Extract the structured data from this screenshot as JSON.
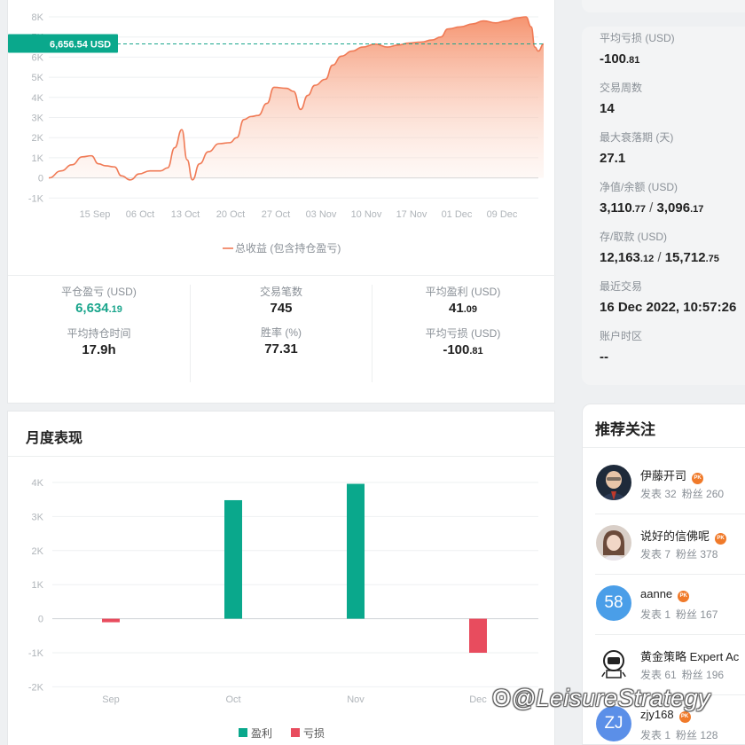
{
  "equity_chart": {
    "y_ticks": [
      "8K",
      "7K",
      "6K",
      "5K",
      "4K",
      "3K",
      "2K",
      "1K",
      "0",
      "-1K"
    ],
    "x_ticks": [
      "15 Sep",
      "06 Oct",
      "13 Oct",
      "20 Oct",
      "27 Oct",
      "03 Nov",
      "10 Nov",
      "17 Nov",
      "01 Dec",
      "09 Dec"
    ],
    "current_value_label": "6,656.54 USD",
    "legend": "总收益 (包含持仓盈亏)",
    "line_color": "#f07a55"
  },
  "stats": {
    "close_pnl": {
      "label": "平仓盈亏 (USD)",
      "int": "6,634",
      "dec": ".19"
    },
    "trade_count": {
      "label": "交易笔数",
      "value": "745"
    },
    "avg_profit": {
      "label": "平均盈利 (USD)",
      "int": "41",
      "dec": ".09"
    },
    "avg_hold_time": {
      "label": "平均持仓时间",
      "value": "17.9h"
    },
    "win_rate": {
      "label": "胜率 (%)",
      "value": "77.31"
    },
    "avg_loss": {
      "label": "平均亏损 (USD)",
      "int": "-100",
      "dec": ".81"
    }
  },
  "monthly": {
    "title": "月度表现",
    "y_ticks": [
      "4K",
      "3K",
      "2K",
      "1K",
      "0",
      "-1K",
      "-2K"
    ],
    "legend_profit": "盈利",
    "legend_loss": "亏损",
    "profit_color": "#0aa88c",
    "loss_color": "#e84c5e"
  },
  "chart_data": [
    {
      "type": "area",
      "series": [
        {
          "name": "总收益 (包含持仓盈亏)",
          "points": [
            [
              "start",
              0
            ],
            [
              "15 Sep",
              1100
            ],
            [
              "late Sep",
              600
            ],
            [
              "06 Oct",
              300
            ],
            [
              "13 Oct",
              2400
            ],
            [
              "13 Oct+",
              -100
            ],
            [
              "20 Oct",
              1700
            ],
            [
              "27 Oct",
              4500
            ],
            [
              "03 Nov",
              5000
            ],
            [
              "10 Nov",
              6600
            ],
            [
              "17 Nov",
              6700
            ],
            [
              "01 Dec",
              7700
            ],
            [
              "09 Dec",
              7900
            ],
            [
              "16 Dec",
              6656.54
            ]
          ]
        }
      ],
      "x_ticks": [
        "15 Sep",
        "06 Oct",
        "13 Oct",
        "20 Oct",
        "27 Oct",
        "03 Nov",
        "10 Nov",
        "17 Nov",
        "01 Dec",
        "09 Dec"
      ],
      "ylim": [
        -1000,
        8000
      ],
      "current_value": 6656.54
    },
    {
      "type": "bar",
      "categories": [
        "Sep",
        "Oct",
        "Nov",
        "Dec"
      ],
      "series": [
        {
          "name": "盈利",
          "values": [
            0,
            3480,
            3960,
            0
          ]
        },
        {
          "name": "亏损",
          "values": [
            -100,
            0,
            0,
            -1000
          ]
        }
      ],
      "ylim": [
        -2000,
        4000
      ]
    }
  ],
  "account_info": [
    {
      "label": "平均亏损 (USD)",
      "int": "-100",
      "dec": ".81"
    },
    {
      "label": "交易周数",
      "value": "14"
    },
    {
      "label": "最大衰落期 (天)",
      "value": "27.1"
    },
    {
      "label": "净值/余额 (USD)",
      "a_int": "3,110",
      "a_dec": ".77",
      "b_int": "3,096",
      "b_dec": ".17"
    },
    {
      "label": "存/取款 (USD)",
      "a_int": "12,163",
      "a_dec": ".12",
      "b_int": "15,712",
      "b_dec": ".75"
    },
    {
      "label": "最近交易",
      "value": "16 Dec 2022, 10:57:26"
    },
    {
      "label": "账户时区",
      "value": "--"
    }
  ],
  "recommend": {
    "title": "推荐关注",
    "users": [
      {
        "name": "伊藤开司",
        "posts": "发表 32",
        "fans": "粉丝 260",
        "avatar": ""
      },
      {
        "name": "说好的信佛呢",
        "posts": "发表 7",
        "fans": "粉丝 378",
        "avatar": ""
      },
      {
        "name": "aanne",
        "posts": "发表 1",
        "fans": "粉丝 167",
        "avatar": "58"
      },
      {
        "name": "黄金策略 Expert Ac",
        "posts": "发表 61",
        "fans": "粉丝 196",
        "avatar": ""
      },
      {
        "name": "zjy168",
        "posts": "发表 1",
        "fans": "粉丝 128",
        "avatar": "ZJ"
      }
    ],
    "pk_badge": "PK"
  },
  "watermark": "@LeisureStrategy"
}
